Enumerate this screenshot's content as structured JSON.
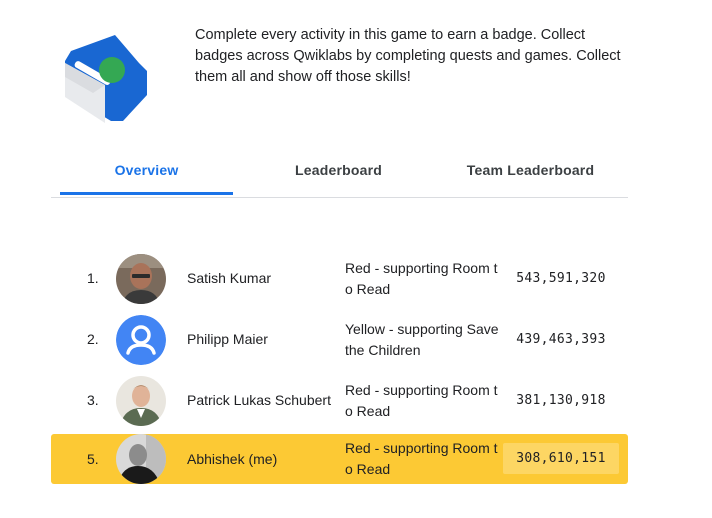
{
  "intro": {
    "text": "Complete every activity in this game to earn a badge. Collect badges across Qwiklabs by completing quests and games. Collect them all and show off those skills!"
  },
  "tabs": [
    {
      "label": "Overview",
      "active": true
    },
    {
      "label": "Leaderboard",
      "active": false
    },
    {
      "label": "Team Leaderboard",
      "active": false
    }
  ],
  "leaderboard": {
    "rows": [
      {
        "rank": "1.",
        "name": "Satish Kumar",
        "team": "Red - supporting Room to Read",
        "score": "543,591,320",
        "avatar": "photo-avatar"
      },
      {
        "rank": "2.",
        "name": "Philipp Maier",
        "team": "Yellow - supporting Save the Children",
        "score": "439,463,393",
        "avatar": "default-user-avatar"
      },
      {
        "rank": "3.",
        "name": "Patrick Lukas Schubert",
        "team": "Red - supporting Room to Read",
        "score": "381,130,918",
        "avatar": "photo-avatar"
      },
      {
        "rank": "5.",
        "name": "Abhishek (me)",
        "team": "Red - supporting Room to Read",
        "score": "308,610,151",
        "avatar": "photo-avatar",
        "current_user": true
      }
    ]
  },
  "colors": {
    "accent": "#1a73e8",
    "highlight_row": "#fcc934",
    "highlight_score": "#fdd663",
    "badge_blue": "#1967d2",
    "badge_green": "#34a853"
  }
}
